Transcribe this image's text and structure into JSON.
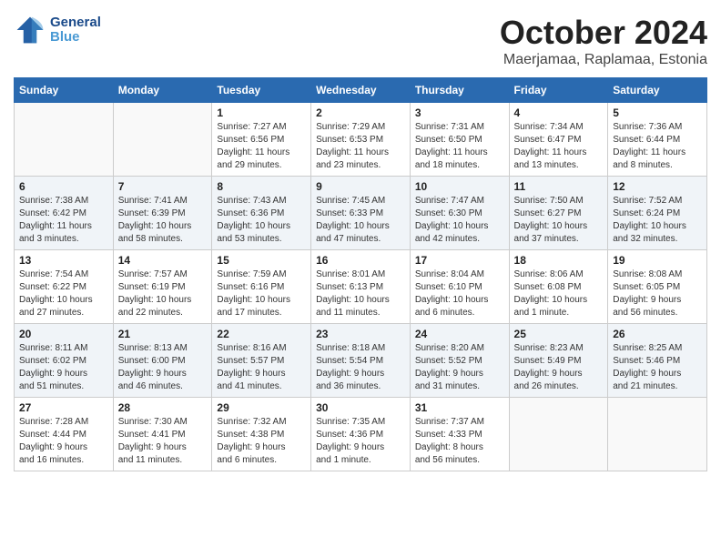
{
  "header": {
    "logo_line1": "General",
    "logo_line2": "Blue",
    "month": "October 2024",
    "location": "Maerjamaa, Raplamaa, Estonia"
  },
  "weekdays": [
    "Sunday",
    "Monday",
    "Tuesday",
    "Wednesday",
    "Thursday",
    "Friday",
    "Saturday"
  ],
  "weeks": [
    [
      {
        "day": "",
        "content": ""
      },
      {
        "day": "",
        "content": ""
      },
      {
        "day": "1",
        "content": "Sunrise: 7:27 AM\nSunset: 6:56 PM\nDaylight: 11 hours\nand 29 minutes."
      },
      {
        "day": "2",
        "content": "Sunrise: 7:29 AM\nSunset: 6:53 PM\nDaylight: 11 hours\nand 23 minutes."
      },
      {
        "day": "3",
        "content": "Sunrise: 7:31 AM\nSunset: 6:50 PM\nDaylight: 11 hours\nand 18 minutes."
      },
      {
        "day": "4",
        "content": "Sunrise: 7:34 AM\nSunset: 6:47 PM\nDaylight: 11 hours\nand 13 minutes."
      },
      {
        "day": "5",
        "content": "Sunrise: 7:36 AM\nSunset: 6:44 PM\nDaylight: 11 hours\nand 8 minutes."
      }
    ],
    [
      {
        "day": "6",
        "content": "Sunrise: 7:38 AM\nSunset: 6:42 PM\nDaylight: 11 hours\nand 3 minutes."
      },
      {
        "day": "7",
        "content": "Sunrise: 7:41 AM\nSunset: 6:39 PM\nDaylight: 10 hours\nand 58 minutes."
      },
      {
        "day": "8",
        "content": "Sunrise: 7:43 AM\nSunset: 6:36 PM\nDaylight: 10 hours\nand 53 minutes."
      },
      {
        "day": "9",
        "content": "Sunrise: 7:45 AM\nSunset: 6:33 PM\nDaylight: 10 hours\nand 47 minutes."
      },
      {
        "day": "10",
        "content": "Sunrise: 7:47 AM\nSunset: 6:30 PM\nDaylight: 10 hours\nand 42 minutes."
      },
      {
        "day": "11",
        "content": "Sunrise: 7:50 AM\nSunset: 6:27 PM\nDaylight: 10 hours\nand 37 minutes."
      },
      {
        "day": "12",
        "content": "Sunrise: 7:52 AM\nSunset: 6:24 PM\nDaylight: 10 hours\nand 32 minutes."
      }
    ],
    [
      {
        "day": "13",
        "content": "Sunrise: 7:54 AM\nSunset: 6:22 PM\nDaylight: 10 hours\nand 27 minutes."
      },
      {
        "day": "14",
        "content": "Sunrise: 7:57 AM\nSunset: 6:19 PM\nDaylight: 10 hours\nand 22 minutes."
      },
      {
        "day": "15",
        "content": "Sunrise: 7:59 AM\nSunset: 6:16 PM\nDaylight: 10 hours\nand 17 minutes."
      },
      {
        "day": "16",
        "content": "Sunrise: 8:01 AM\nSunset: 6:13 PM\nDaylight: 10 hours\nand 11 minutes."
      },
      {
        "day": "17",
        "content": "Sunrise: 8:04 AM\nSunset: 6:10 PM\nDaylight: 10 hours\nand 6 minutes."
      },
      {
        "day": "18",
        "content": "Sunrise: 8:06 AM\nSunset: 6:08 PM\nDaylight: 10 hours\nand 1 minute."
      },
      {
        "day": "19",
        "content": "Sunrise: 8:08 AM\nSunset: 6:05 PM\nDaylight: 9 hours\nand 56 minutes."
      }
    ],
    [
      {
        "day": "20",
        "content": "Sunrise: 8:11 AM\nSunset: 6:02 PM\nDaylight: 9 hours\nand 51 minutes."
      },
      {
        "day": "21",
        "content": "Sunrise: 8:13 AM\nSunset: 6:00 PM\nDaylight: 9 hours\nand 46 minutes."
      },
      {
        "day": "22",
        "content": "Sunrise: 8:16 AM\nSunset: 5:57 PM\nDaylight: 9 hours\nand 41 minutes."
      },
      {
        "day": "23",
        "content": "Sunrise: 8:18 AM\nSunset: 5:54 PM\nDaylight: 9 hours\nand 36 minutes."
      },
      {
        "day": "24",
        "content": "Sunrise: 8:20 AM\nSunset: 5:52 PM\nDaylight: 9 hours\nand 31 minutes."
      },
      {
        "day": "25",
        "content": "Sunrise: 8:23 AM\nSunset: 5:49 PM\nDaylight: 9 hours\nand 26 minutes."
      },
      {
        "day": "26",
        "content": "Sunrise: 8:25 AM\nSunset: 5:46 PM\nDaylight: 9 hours\nand 21 minutes."
      }
    ],
    [
      {
        "day": "27",
        "content": "Sunrise: 7:28 AM\nSunset: 4:44 PM\nDaylight: 9 hours\nand 16 minutes."
      },
      {
        "day": "28",
        "content": "Sunrise: 7:30 AM\nSunset: 4:41 PM\nDaylight: 9 hours\nand 11 minutes."
      },
      {
        "day": "29",
        "content": "Sunrise: 7:32 AM\nSunset: 4:38 PM\nDaylight: 9 hours\nand 6 minutes."
      },
      {
        "day": "30",
        "content": "Sunrise: 7:35 AM\nSunset: 4:36 PM\nDaylight: 9 hours\nand 1 minute."
      },
      {
        "day": "31",
        "content": "Sunrise: 7:37 AM\nSunset: 4:33 PM\nDaylight: 8 hours\nand 56 minutes."
      },
      {
        "day": "",
        "content": ""
      },
      {
        "day": "",
        "content": ""
      }
    ]
  ]
}
